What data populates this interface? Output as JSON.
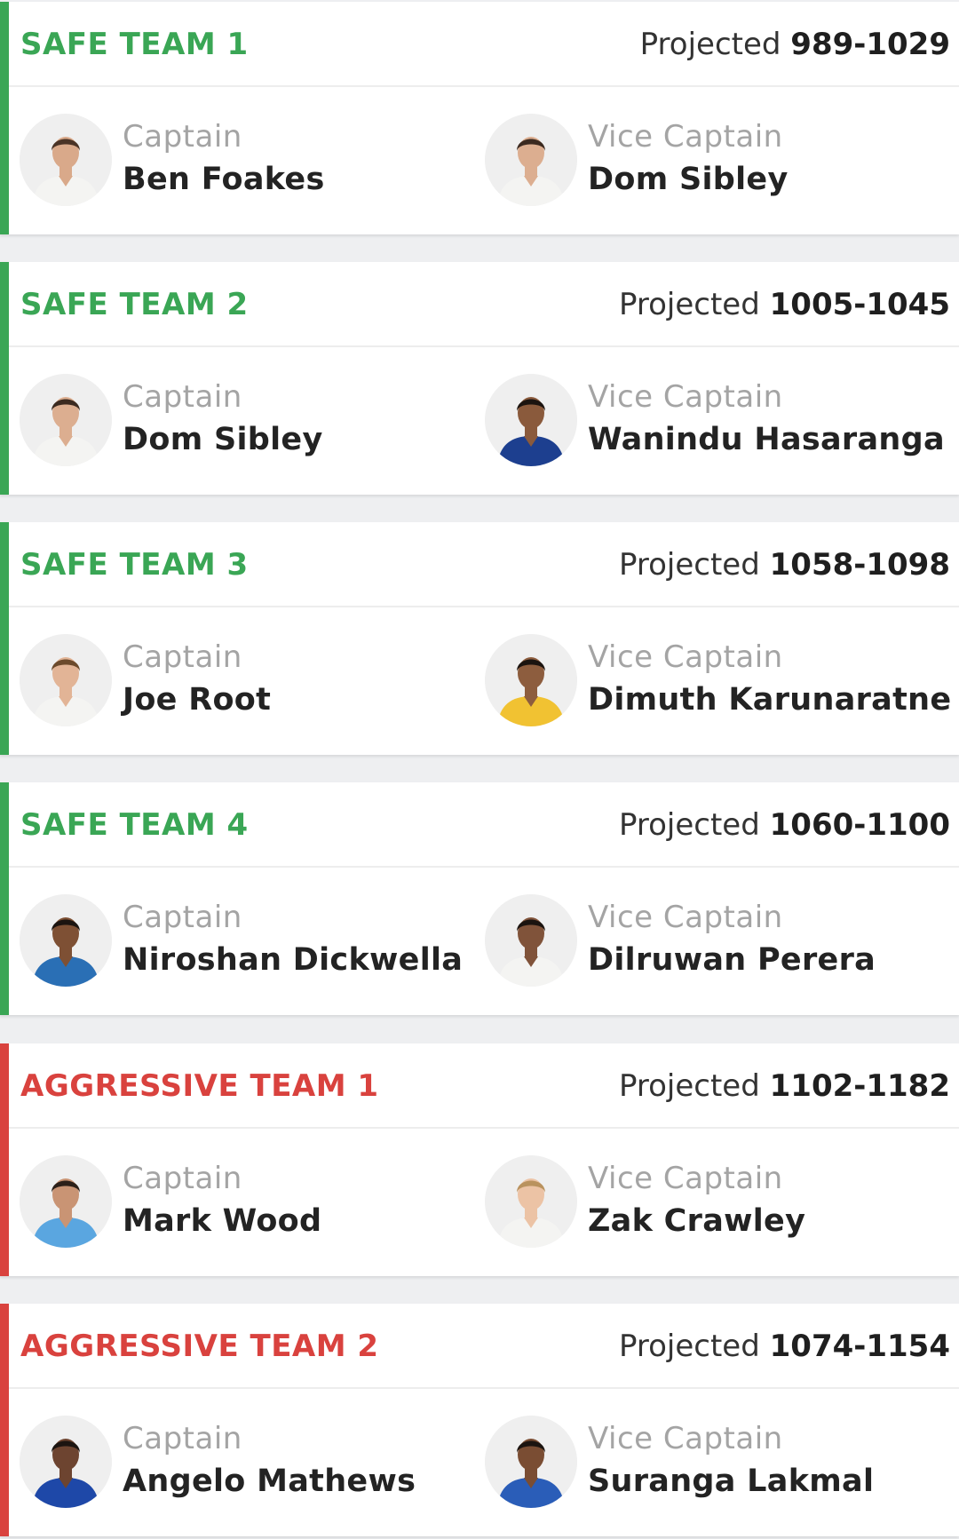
{
  "teams": [
    {
      "name": "SAFE TEAM 1",
      "type": "safe",
      "projected_label": "Projected",
      "projected_range": "989-1029",
      "captain": {
        "role": "Captain",
        "name": "Ben Foakes",
        "jersey": "#f4f4f2",
        "skin": "#d9a98a",
        "hair": "#4a3326"
      },
      "vice": {
        "role": "Vice Captain",
        "name": "Dom Sibley",
        "jersey": "#f4f4f2",
        "skin": "#dcae90",
        "hair": "#3b2a20"
      }
    },
    {
      "name": "SAFE TEAM 2",
      "type": "safe",
      "projected_label": "Projected",
      "projected_range": "1005-1045",
      "captain": {
        "role": "Captain",
        "name": "Dom Sibley",
        "jersey": "#f4f4f2",
        "skin": "#dcae90",
        "hair": "#3b2a20"
      },
      "vice": {
        "role": "Vice Captain",
        "name": "Wanindu Hasaranga",
        "jersey": "#1d3f8f",
        "skin": "#8a5a3c",
        "hair": "#1b1410"
      }
    },
    {
      "name": "SAFE TEAM 3",
      "type": "safe",
      "projected_label": "Projected",
      "projected_range": "1058-1098",
      "captain": {
        "role": "Captain",
        "name": "Joe Root",
        "jersey": "#f4f4f2",
        "skin": "#e2b496",
        "hair": "#6b4a2c"
      },
      "vice": {
        "role": "Vice Captain",
        "name": "Dimuth Karunaratne",
        "jersey": "#f1c232",
        "skin": "#8d5d3e",
        "hair": "#1b1410"
      }
    },
    {
      "name": "SAFE TEAM 4",
      "type": "safe",
      "projected_label": "Projected",
      "projected_range": "1060-1100",
      "captain": {
        "role": "Captain",
        "name": "Niroshan Dickwella",
        "jersey": "#2a6fb5",
        "skin": "#7e5034",
        "hair": "#1b1410"
      },
      "vice": {
        "role": "Vice Captain",
        "name": "Dilruwan Perera",
        "jersey": "#f4f4f2",
        "skin": "#80533a",
        "hair": "#1b1410"
      }
    },
    {
      "name": "AGGRESSIVE TEAM 1",
      "type": "aggressive",
      "projected_label": "Projected",
      "projected_range": "1102-1182",
      "captain": {
        "role": "Captain",
        "name": "Mark Wood",
        "jersey": "#5aa6e0",
        "skin": "#c99474",
        "hair": "#2c2019"
      },
      "vice": {
        "role": "Vice Captain",
        "name": "Zak Crawley",
        "jersey": "#f4f4f2",
        "skin": "#ecc3a5",
        "hair": "#b9925e"
      }
    },
    {
      "name": "AGGRESSIVE TEAM 2",
      "type": "aggressive",
      "projected_label": "Projected",
      "projected_range": "1074-1154",
      "captain": {
        "role": "Captain",
        "name": "Angelo Mathews",
        "jersey": "#1e48a8",
        "skin": "#6d4430",
        "hair": "#1b1410"
      },
      "vice": {
        "role": "Vice Captain",
        "name": "Suranga Lakmal",
        "jersey": "#2a5db8",
        "skin": "#7a4d33",
        "hair": "#1b1410"
      }
    }
  ]
}
